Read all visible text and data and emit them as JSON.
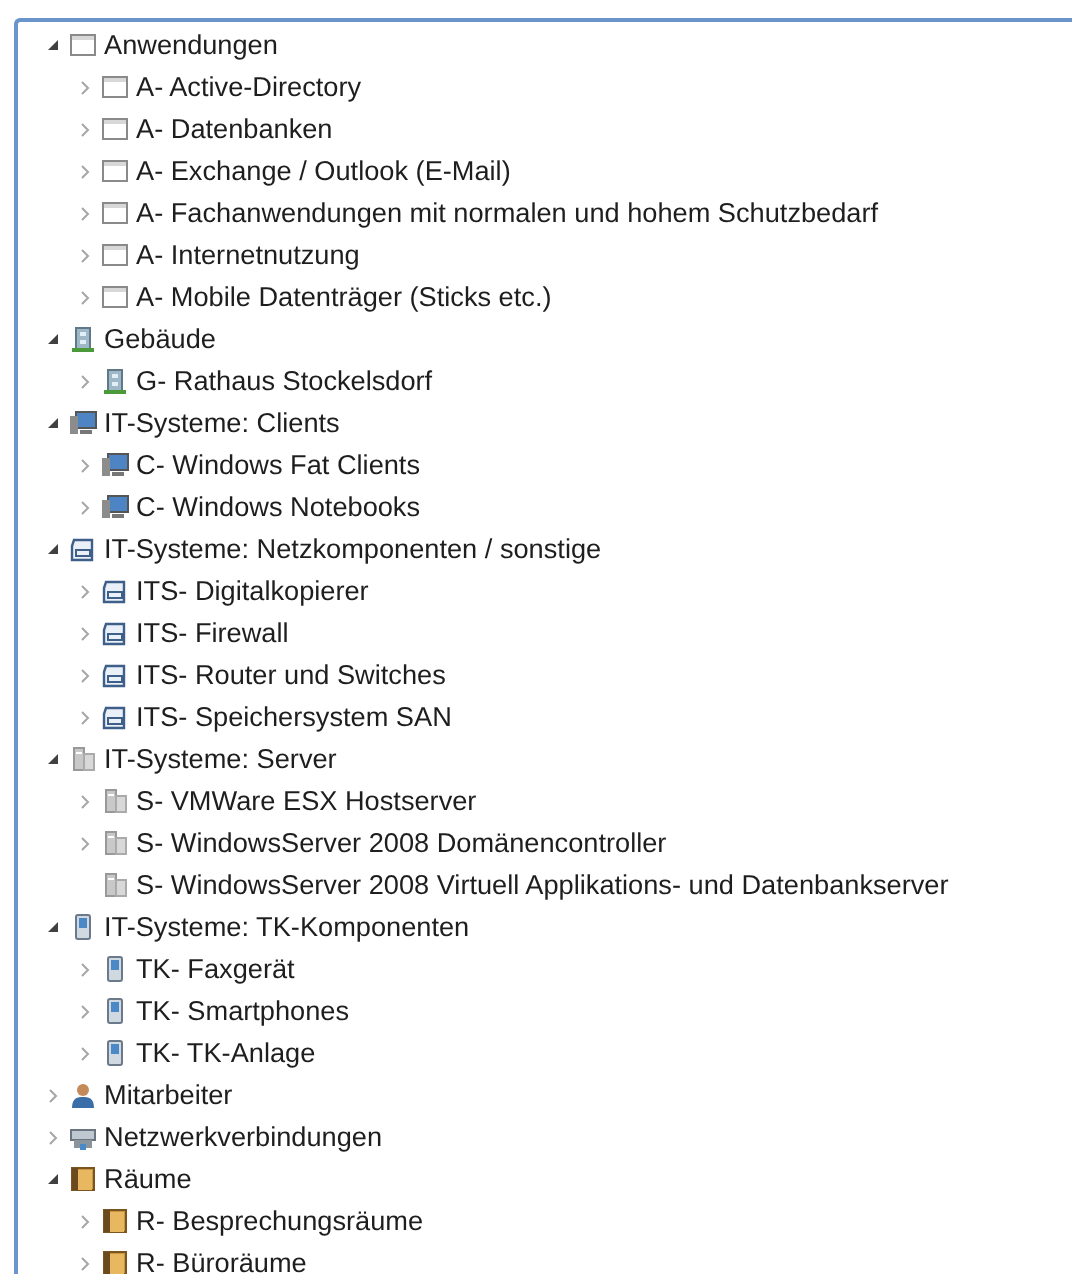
{
  "tree": [
    {
      "label": "Anwendungen",
      "kind": "window",
      "expanded": true,
      "children": [
        {
          "label": "A- Active-Directory",
          "kind": "window",
          "expanded": false
        },
        {
          "label": "A- Datenbanken",
          "kind": "window",
          "expanded": false
        },
        {
          "label": "A- Exchange / Outlook (E-Mail)",
          "kind": "window",
          "expanded": false
        },
        {
          "label": "A- Fachanwendungen mit normalen und hohem Schutzbedarf",
          "kind": "window",
          "expanded": false
        },
        {
          "label": "A- Internetnutzung",
          "kind": "window",
          "expanded": false
        },
        {
          "label": "A- Mobile Datenträger (Sticks etc.)",
          "kind": "window",
          "expanded": false
        }
      ]
    },
    {
      "label": "Gebäude",
      "kind": "building",
      "expanded": true,
      "children": [
        {
          "label": "G- Rathaus Stockelsdorf",
          "kind": "building",
          "expanded": false
        }
      ]
    },
    {
      "label": "IT-Systeme: Clients",
      "kind": "computer",
      "expanded": true,
      "children": [
        {
          "label": "C- Windows Fat Clients",
          "kind": "computer",
          "expanded": false
        },
        {
          "label": "C- Windows Notebooks",
          "kind": "computer",
          "expanded": false
        }
      ]
    },
    {
      "label": "IT-Systeme: Netzkomponenten / sonstige",
      "kind": "device",
      "expanded": true,
      "children": [
        {
          "label": "ITS- Digitalkopierer",
          "kind": "device",
          "expanded": false
        },
        {
          "label": "ITS- Firewall",
          "kind": "device",
          "expanded": false
        },
        {
          "label": "ITS- Router und Switches",
          "kind": "device",
          "expanded": false
        },
        {
          "label": "ITS- Speichersystem SAN",
          "kind": "device",
          "expanded": false
        }
      ]
    },
    {
      "label": "IT-Systeme: Server",
      "kind": "server",
      "expanded": true,
      "children": [
        {
          "label": "S- VMWare ESX Hostserver",
          "kind": "server",
          "expanded": false
        },
        {
          "label": "S- WindowsServer 2008 Domänencontroller",
          "kind": "server",
          "expanded": false
        },
        {
          "label": "S- WindowsServer 2008 Virtuell Applikations- und Datenbankserver",
          "kind": "server"
        }
      ]
    },
    {
      "label": "IT-Systeme: TK-Komponenten",
      "kind": "phone",
      "expanded": true,
      "children": [
        {
          "label": "TK- Faxgerät",
          "kind": "phone",
          "expanded": false
        },
        {
          "label": "TK- Smartphones",
          "kind": "phone",
          "expanded": false
        },
        {
          "label": "TK- TK-Anlage",
          "kind": "phone",
          "expanded": false
        }
      ]
    },
    {
      "label": "Mitarbeiter",
      "kind": "person",
      "expanded": false
    },
    {
      "label": "Netzwerkverbindungen",
      "kind": "network",
      "expanded": false
    },
    {
      "label": "Räume",
      "kind": "door",
      "expanded": true,
      "children": [
        {
          "label": "R- Besprechungsräume",
          "kind": "door",
          "expanded": false
        },
        {
          "label": "R- Büroräume",
          "kind": "door",
          "expanded": false
        }
      ]
    }
  ]
}
